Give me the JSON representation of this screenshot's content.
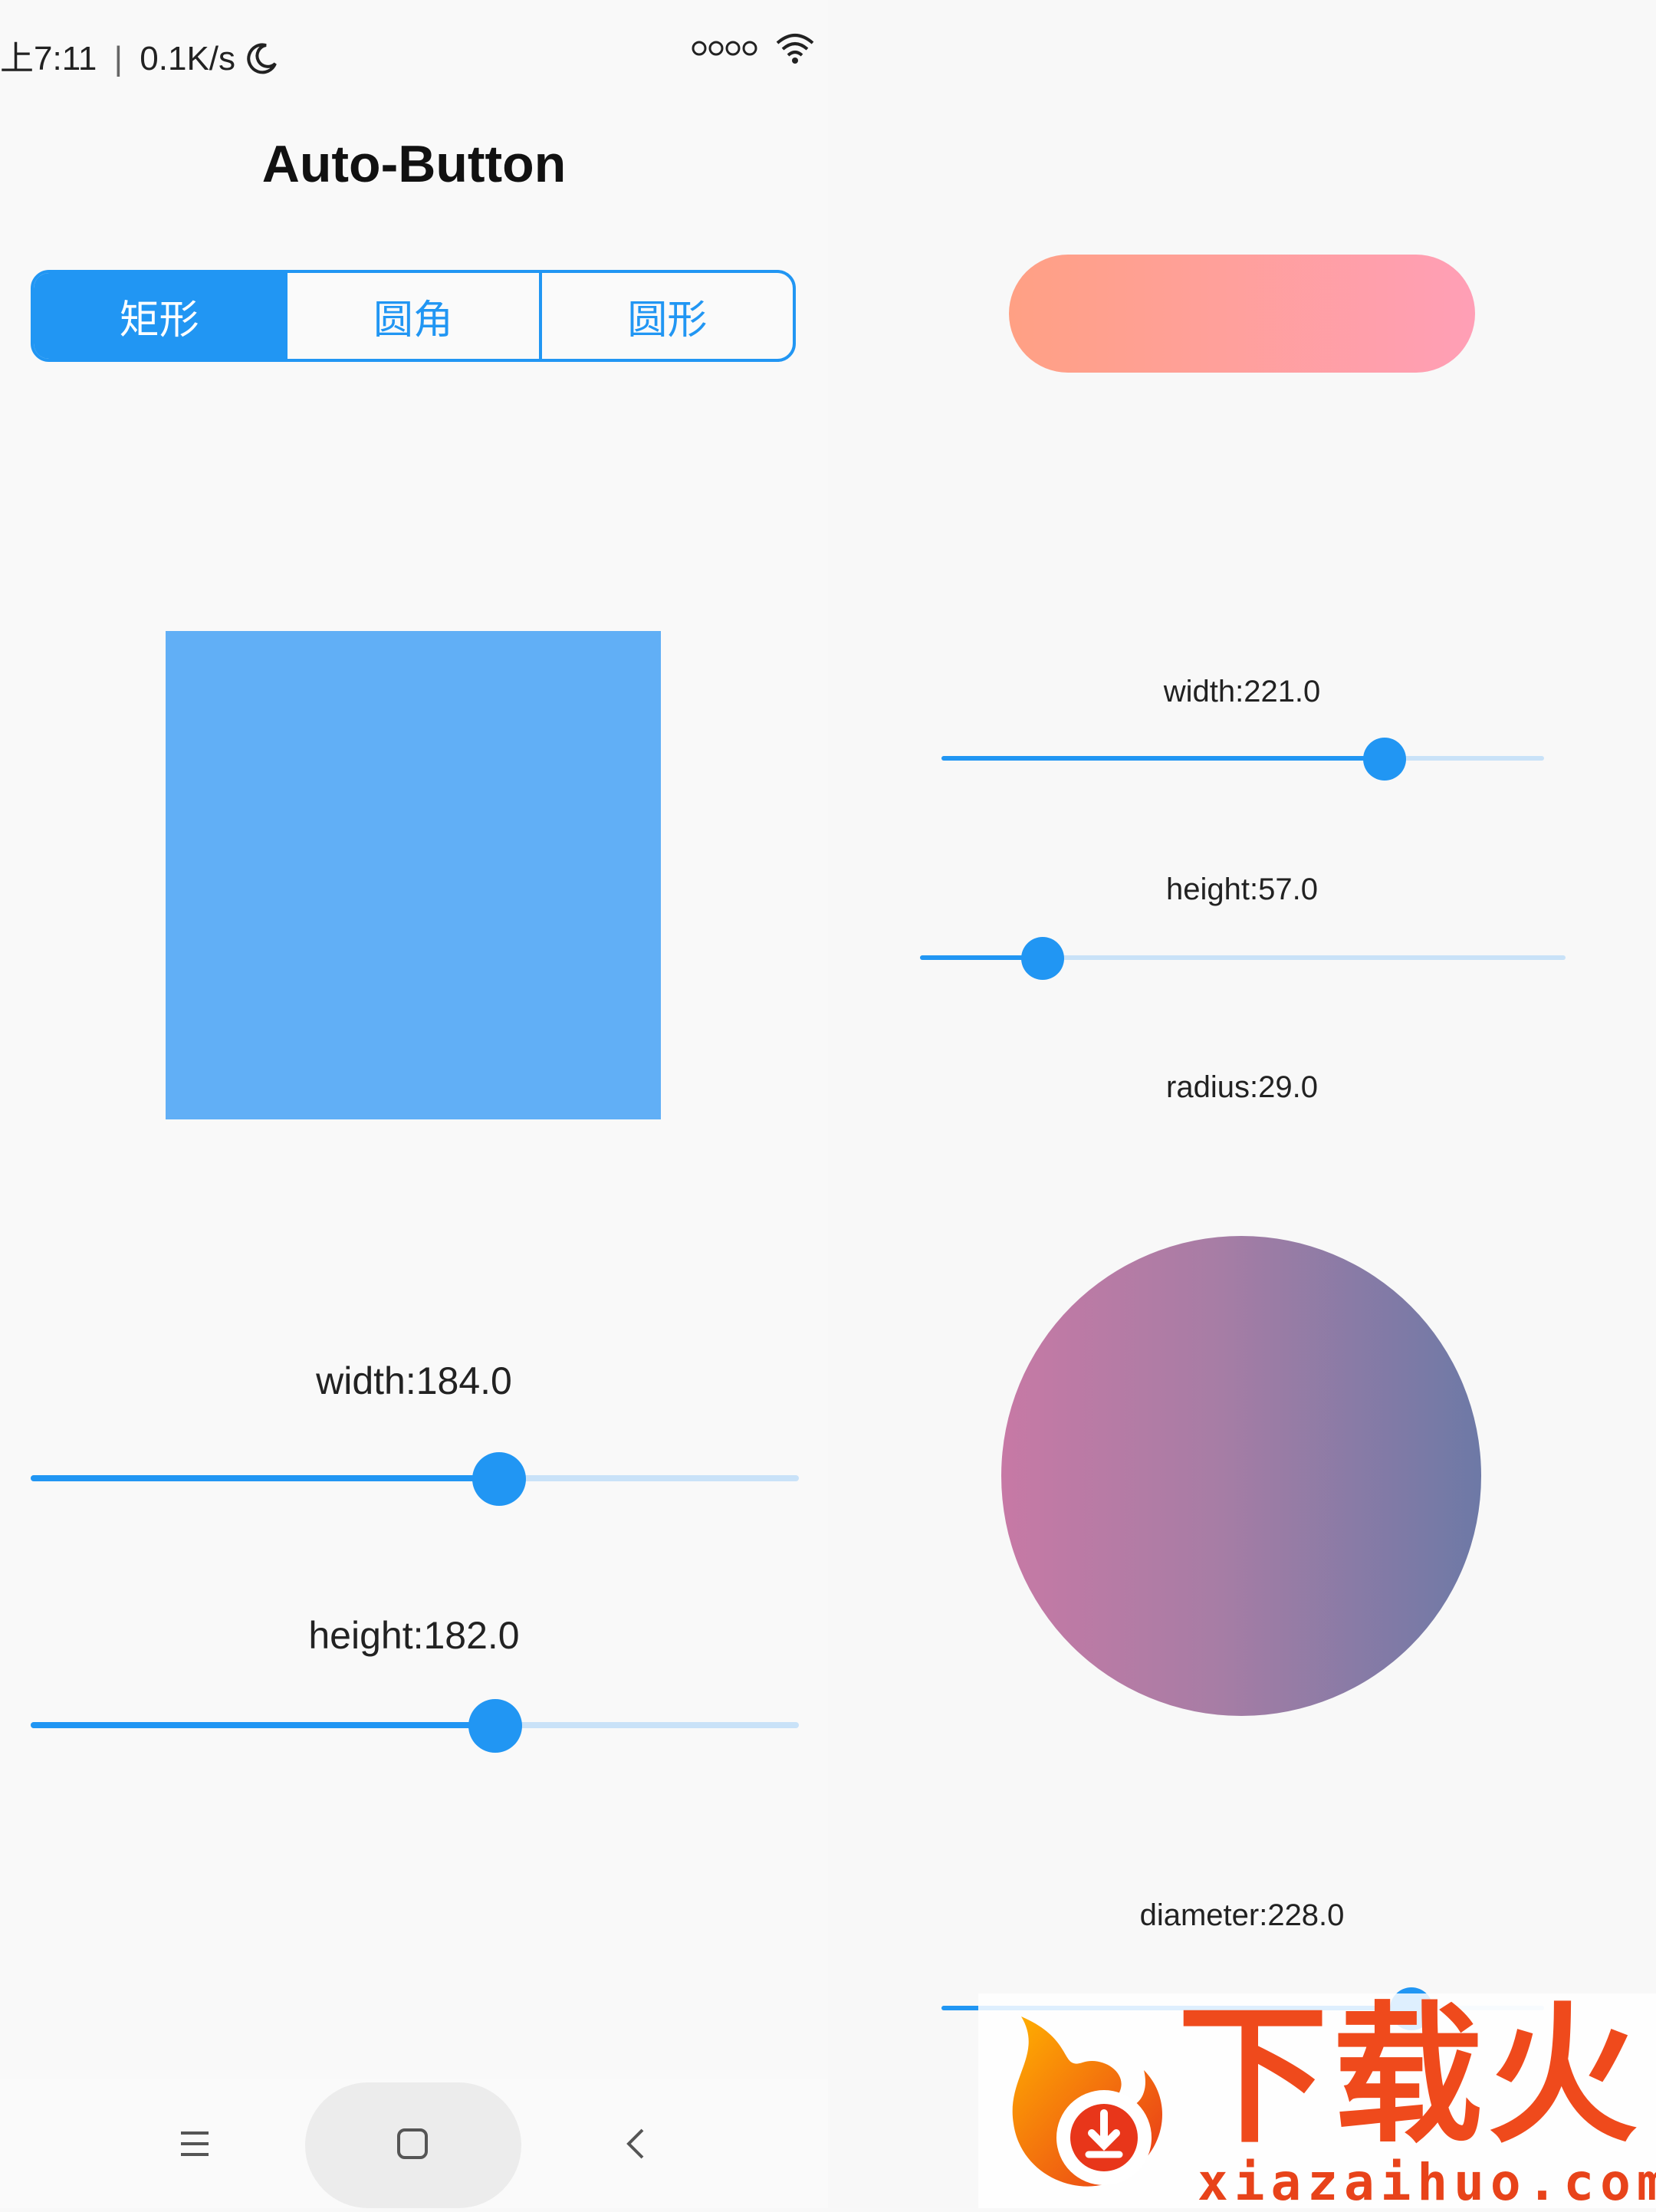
{
  "status_bar": {
    "time": "上7:11",
    "network_speed": "0.1K/s",
    "signal_icon": "signal-dots-icon",
    "wifi_icon": "wifi-icon",
    "moon_icon": "moon-icon"
  },
  "page": {
    "title": "Auto-Button"
  },
  "segmented": {
    "options": [
      "矩形",
      "圆角",
      "圆形"
    ],
    "selected_index": 0
  },
  "left_sliders": [
    {
      "label": "width:184.0",
      "value": 184.0,
      "fraction": 0.61
    },
    {
      "label": "height:182.0",
      "value": 182.0,
      "fraction": 0.605
    }
  ],
  "right_sliders": [
    {
      "label": "width:221.0",
      "value": 221.0,
      "fraction": 0.735
    },
    {
      "label": "height:57.0",
      "value": 57.0,
      "fraction": 0.19
    }
  ],
  "radius": {
    "label": "radius:29.0",
    "value": 29.0
  },
  "diameter": {
    "label": "diameter:228.0",
    "value": 228.0,
    "fraction": 0.78
  },
  "nav": {
    "menu_icon": "menu-icon",
    "home_icon": "home-square-icon",
    "back_icon": "back-chevron-icon"
  },
  "watermark": {
    "brand_cn": "下载火",
    "brand_en": "xiazaihuo.com"
  },
  "colors": {
    "accent": "#2196f3",
    "preview_rect": "#61aff6",
    "button_gradient_start": "#ffa084",
    "button_gradient_end": "#ff9fb6",
    "circle_gradient_start": "#c779a5",
    "circle_gradient_end": "#6d79a6"
  }
}
